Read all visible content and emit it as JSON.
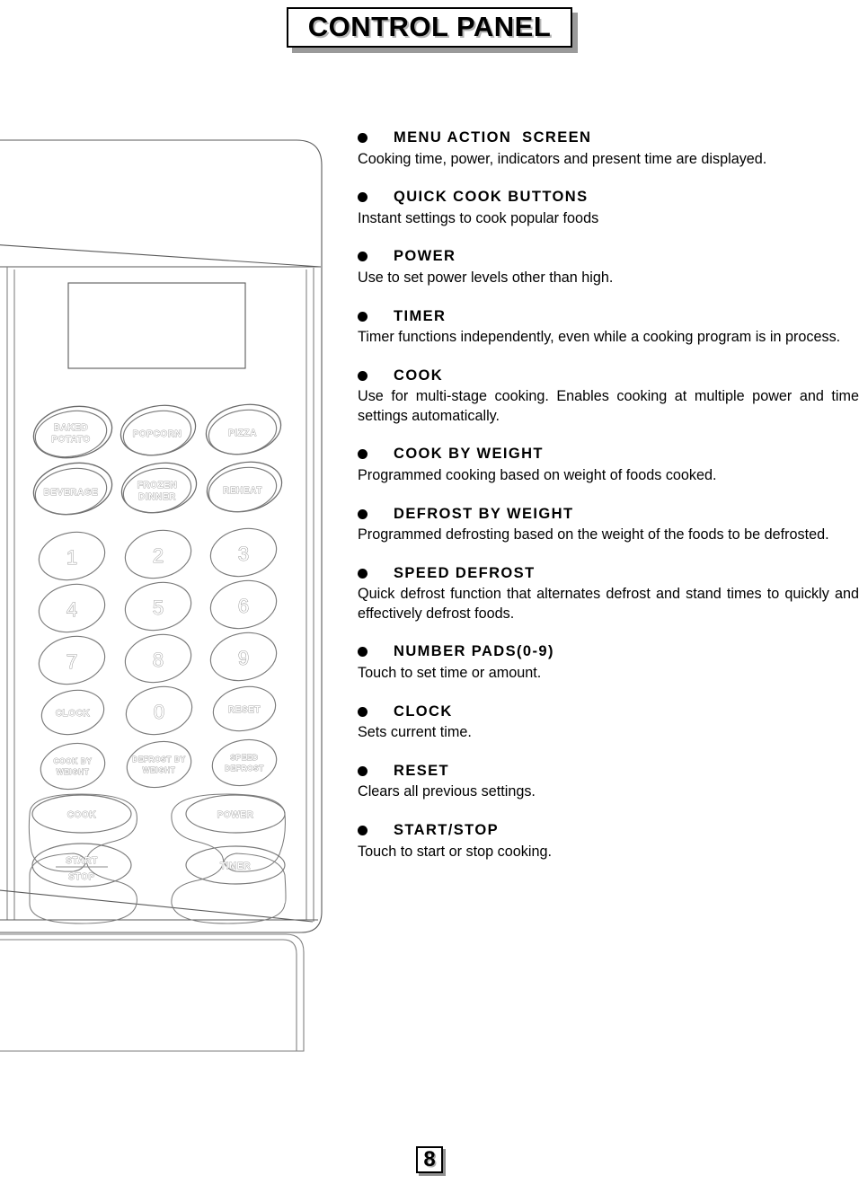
{
  "page": {
    "title": "CONTROL PANEL",
    "page_number": "8"
  },
  "descriptions": [
    {
      "bullet": "filled-dot",
      "heading": "MENU ACTION  SCREEN",
      "body": "Cooking time, power, indicators and present time are displayed.",
      "justified": false
    },
    {
      "bullet": "filled-dot",
      "heading": "QUICK COOK BUTTONS",
      "body": "Instant settings to cook popular foods",
      "justified": false
    },
    {
      "bullet": "filled-dot",
      "heading": "POWER",
      "body": "Use to set power levels other than high.",
      "justified": false
    },
    {
      "bullet": "filled-dot",
      "heading": "TIMER",
      "body": "Timer functions independently, even while a cooking program is in process.",
      "justified": true
    },
    {
      "bullet": "filled-dot",
      "heading": "COOK",
      "body": "Use for multi-stage cooking.   Enables cooking at multiple power and time settings automatically.",
      "justified": true
    },
    {
      "bullet": "filled-dot",
      "heading": "COOK BY WEIGHT",
      "body": "Programmed cooking based on weight of foods cooked.",
      "justified": false
    },
    {
      "bullet": "filled-dot",
      "heading": "DEFROST BY WEIGHT",
      "body": "Programmed defrosting based on the weight of the foods to be defrosted.",
      "justified": true
    },
    {
      "bullet": "filled-dot",
      "heading": "SPEED DEFROST",
      "body": "Quick defrost function that alternates defrost and stand times to quickly and effectively defrost foods.",
      "justified": true
    },
    {
      "bullet": "filled-dot",
      "heading": "NUMBER PADS(0-9)",
      "body": "Touch to set time or amount.",
      "justified": false
    },
    {
      "bullet": "filled-dot",
      "heading": "CLOCK",
      "body": "Sets current time.",
      "justified": false
    },
    {
      "bullet": "filled-dot",
      "heading": "RESET",
      "body": "Clears all previous settings.",
      "justified": false
    },
    {
      "bullet": "filled-dot",
      "heading": "START/STOP",
      "body": "Touch to start or stop cooking.",
      "justified": false
    }
  ],
  "control_panel": {
    "display_screen": {
      "label": "menu-action-screen",
      "value": ""
    },
    "quick_cook_buttons": [
      {
        "label": "BAKED\nPOTATO",
        "lines": [
          "BAKED",
          "POTATO"
        ]
      },
      {
        "label": "POPCORN",
        "lines": [
          "POPCORN"
        ]
      },
      {
        "label": "PIZZA",
        "lines": [
          "PIZZA"
        ]
      },
      {
        "label": "BEVERAGE",
        "lines": [
          "BEVERAGE"
        ]
      },
      {
        "label": "FROZEN\nDINNER",
        "lines": [
          "FROZEN",
          "DINNER"
        ]
      },
      {
        "label": "REHEAT",
        "lines": [
          "REHEAT"
        ]
      }
    ],
    "number_pads": [
      "1",
      "2",
      "3",
      "4",
      "5",
      "6",
      "7",
      "8",
      "9",
      "0"
    ],
    "function_buttons": [
      {
        "label": "CLOCK",
        "lines": [
          "CLOCK"
        ]
      },
      {
        "label": "RESET",
        "lines": [
          "RESET"
        ]
      },
      {
        "label": "COOK BY WEIGHT",
        "lines": [
          "COOK BY",
          "WEIGHT"
        ]
      },
      {
        "label": "DEFROST BY WEIGHT",
        "lines": [
          "DEFROST BY",
          "WEIGHT"
        ]
      },
      {
        "label": "SPEED DEFROST",
        "lines": [
          "SPEED",
          "DEFROST"
        ]
      }
    ],
    "main_buttons": [
      {
        "label": "COOK",
        "lines": [
          "COOK"
        ]
      },
      {
        "label": "POWER",
        "lines": [
          "POWER"
        ]
      },
      {
        "label": "START/STOP",
        "lines": [
          "START",
          "STOP"
        ]
      },
      {
        "label": "TIMER",
        "lines": [
          "TIMER"
        ]
      }
    ]
  },
  "colors": {
    "ink": "#000000",
    "line": "#5a5a5a",
    "line_light": "#8c8c8c",
    "shadow": "#a8a8a8",
    "background": "#ffffff"
  }
}
